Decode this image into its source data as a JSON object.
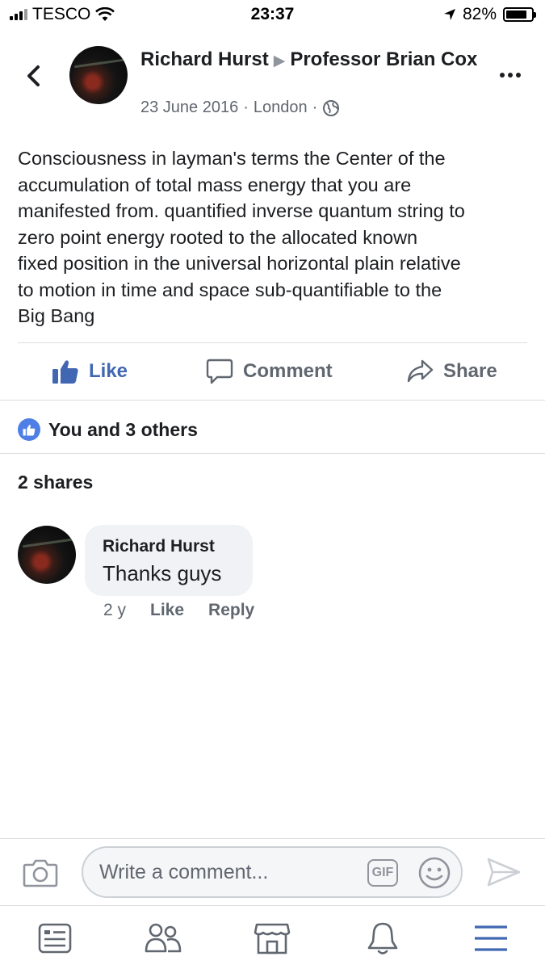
{
  "status_bar": {
    "carrier": "TESCO",
    "time": "23:37",
    "battery_percent": "82%",
    "battery_level": 0.82
  },
  "post": {
    "author": "Richard Hurst",
    "target": "Professor Brian Cox",
    "date": "23 June 2016",
    "location": "London",
    "separator": "·",
    "privacy_icon": "globe-icon",
    "text": "Consciousness in layman's terms the Center of the\naccumulation of total mass energy that you are\nmanifested from. quantified inverse quantum string to\nzero point energy rooted to  the  allocated known\nfixed position in the universal horizontal plain relative\nto  motion  in time and space  sub-quantifiable to the\nBig Bang"
  },
  "actions": {
    "like": "Like",
    "comment": "Comment",
    "share": "Share"
  },
  "reactions": {
    "summary": "You and 3 others",
    "shares": "2 shares"
  },
  "comment": {
    "author": "Richard Hurst",
    "text": "Thanks guys",
    "age": "2 y",
    "like": "Like",
    "reply": "Reply"
  },
  "composer": {
    "placeholder": "Write a comment...",
    "gif_label": "GIF"
  },
  "tab_bar": {
    "items": [
      "news-feed-icon",
      "friends-icon",
      "marketplace-icon",
      "notifications-icon",
      "menu-icon"
    ],
    "active_color": "#4267b2"
  },
  "colors": {
    "accent": "#4267b2",
    "secondary_text": "#606770"
  }
}
